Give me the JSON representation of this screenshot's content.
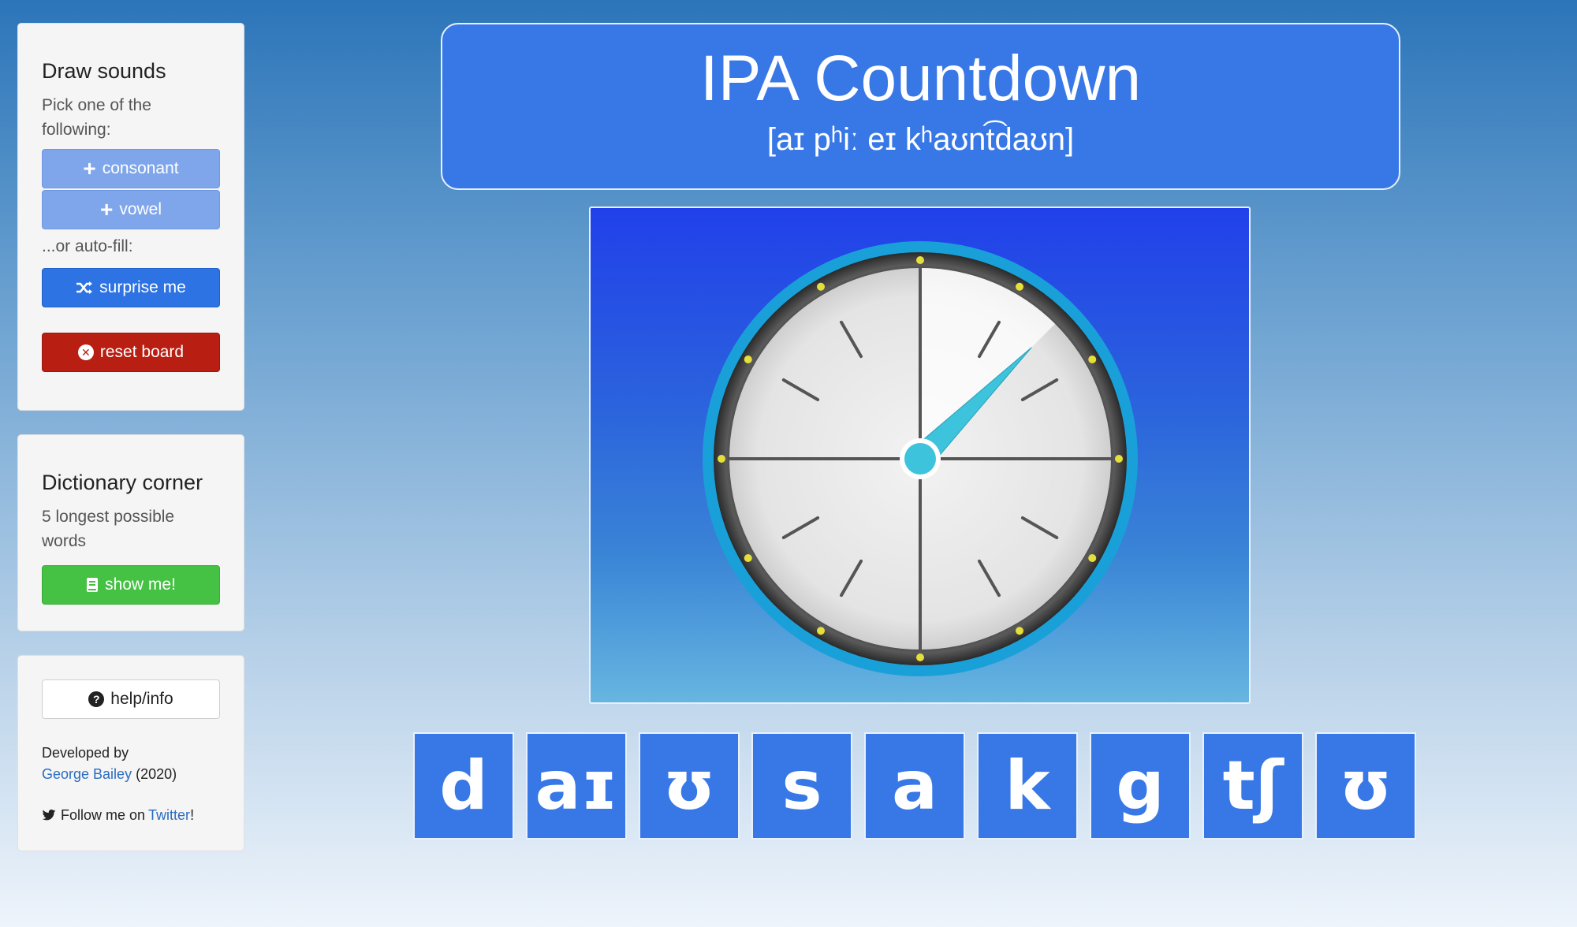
{
  "draw_panel": {
    "title": "Draw sounds",
    "subtitle": "Pick one of the following:",
    "consonant_label": "consonant",
    "vowel_label": "vowel",
    "autofill_text": "...or auto-fill:",
    "surprise_label": "surprise me",
    "reset_label": "reset board"
  },
  "dictionary_panel": {
    "title": "Dictionary corner",
    "subtitle": "5 longest possible words",
    "show_label": "show me!"
  },
  "info_panel": {
    "help_label": "help/info",
    "developed_by": "Developed by",
    "author": "George Bailey",
    "year": "(2020)",
    "follow_text": "Follow me on",
    "twitter_label": "Twitter",
    "exclaim": "!"
  },
  "header": {
    "title": "IPA Countdown",
    "transcription": "[aɪ pʰiː eɪ kʰaʊnt͡daʊn]"
  },
  "clock": {
    "elapsed_fraction": 0.125
  },
  "tiles": [
    "d",
    "aɪ",
    "ʊ",
    "s",
    "a",
    "k",
    "g",
    "tʃ",
    "ʊ"
  ],
  "colors": {
    "accent_blue": "#3878e6",
    "danger_red": "#b81e12",
    "success_green": "#45c144",
    "clock_hand": "#3ec3dc"
  },
  "icons": {
    "plus": "plus-icon",
    "shuffle": "shuffle-icon",
    "reset": "times-circle-icon",
    "book": "book-icon",
    "help": "question-circle-icon",
    "twitter": "twitter-icon"
  }
}
